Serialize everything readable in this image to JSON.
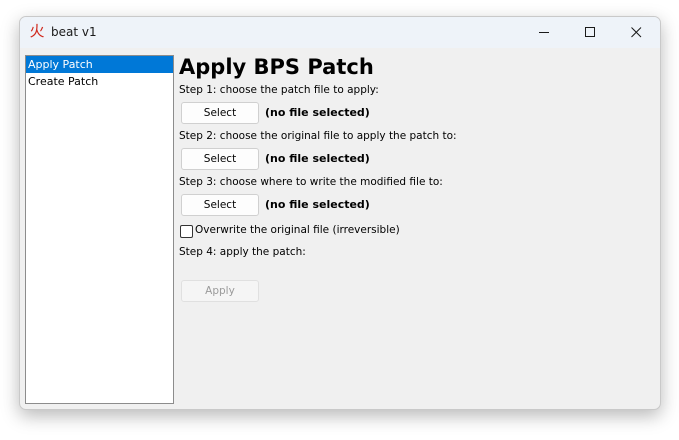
{
  "window": {
    "title": "beat v1",
    "app_icon_glyph": "火",
    "controls": [
      "minimize-icon",
      "maximize-icon",
      "close-icon"
    ]
  },
  "sidebar": {
    "items": [
      {
        "label": "Apply Patch",
        "selected": true
      },
      {
        "label": "Create Patch",
        "selected": false
      }
    ]
  },
  "main": {
    "title": "Apply BPS Patch",
    "step1": {
      "label": "Step 1: choose the patch file to apply:",
      "button": "Select",
      "status": "(no file selected)"
    },
    "step2": {
      "label": "Step 2: choose the original file to apply the patch to:",
      "button": "Select",
      "status": "(no file selected)"
    },
    "step3": {
      "label": "Step 3: choose where to write the modified file to:",
      "button": "Select",
      "status": "(no file selected)"
    },
    "overwrite": {
      "label": "Overwrite the original file (irreversible)",
      "checked": false
    },
    "step4": {
      "label": "Step 4: apply the patch:",
      "button": "Apply",
      "enabled": false
    }
  },
  "colors": {
    "selection": "#0078d7",
    "window_bg": "#f0f0f0",
    "titlebar_bg": "#eef3f9",
    "icon_red": "#d0281c"
  }
}
